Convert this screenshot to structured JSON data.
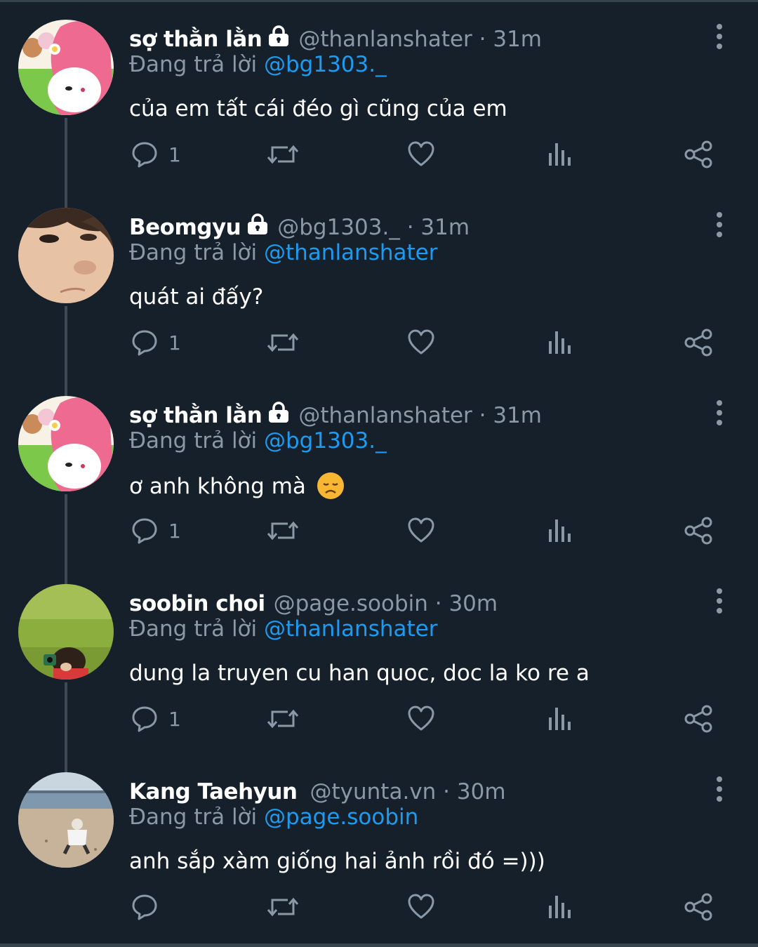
{
  "colors": {
    "background": "#15202b",
    "text": "#ffffff",
    "secondary": "#8b98a5",
    "accent": "#1d9bf0",
    "thread_line": "#3d4a55"
  },
  "icons": {
    "reply": "reply-icon",
    "retweet": "retweet-icon",
    "like": "heart-icon",
    "analytics": "analytics-icon",
    "share": "share-icon",
    "more": "more-icon",
    "lock": "lock-icon"
  },
  "reply_prefix": "Đang trả lời",
  "tweets": [
    {
      "name": "sợ thằn lằn",
      "handle_time": "@thanlanshater · 31m",
      "protected": true,
      "reply_to": "@bg1303._",
      "text": "của em tất cái đéo gì cũng của em",
      "reply_count": "1"
    },
    {
      "name": "Beomgyu",
      "handle_time": "@bg1303._ · 31m",
      "protected": true,
      "reply_to": "@thanlanshater",
      "text": "quát ai đấy?",
      "reply_count": "1"
    },
    {
      "name": "sợ thằn lằn",
      "handle_time": "@thanlanshater · 31m",
      "protected": true,
      "reply_to": "@bg1303._",
      "text": "ơ anh không mà",
      "emoji": "disappointed-face-emoji",
      "reply_count": "1"
    },
    {
      "name": "soobin choi",
      "handle_time": "@page.soobin · 30m",
      "protected": false,
      "reply_to": "@thanlanshater",
      "text": "dung la truyen cu han quoc, doc la ko re a",
      "reply_count": "1"
    },
    {
      "name": "Kang Taehyun",
      "handle_time": "@tyunta.vn · 30m",
      "protected": false,
      "reply_to": "@page.soobin",
      "text": "anh sắp xàm giống hai ảnh rồi đó =)))",
      "reply_count": ""
    }
  ]
}
